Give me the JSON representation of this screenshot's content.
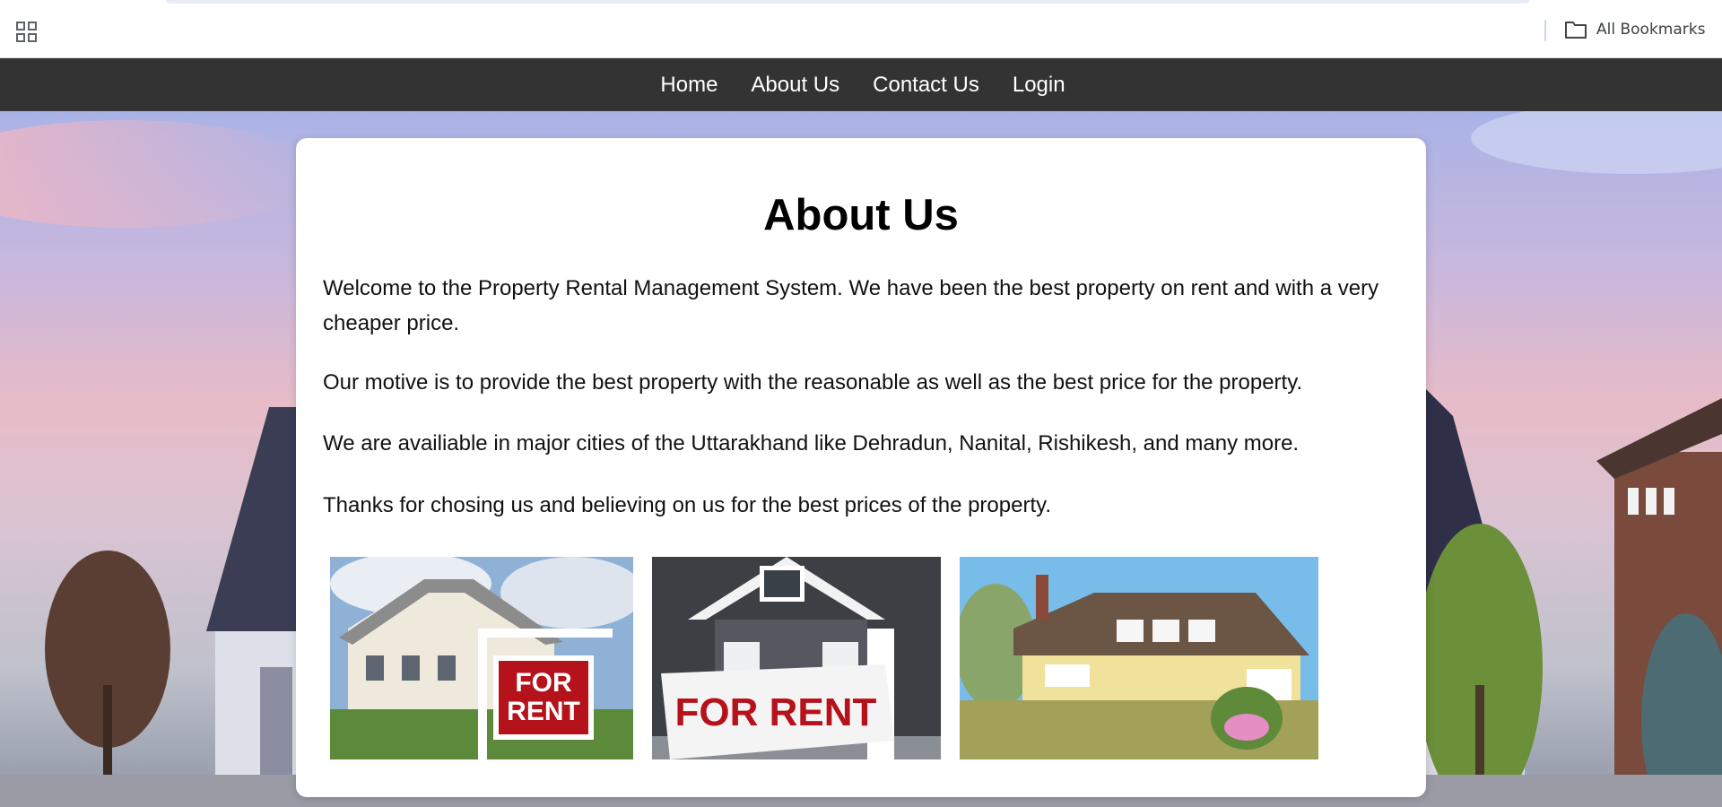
{
  "browser": {
    "apps_icon": "apps-grid-icon",
    "bookmarks_folder_icon": "folder-icon",
    "all_bookmarks_label": "All Bookmarks"
  },
  "nav": {
    "items": [
      {
        "label": "Home"
      },
      {
        "label": "About Us"
      },
      {
        "label": "Contact Us"
      },
      {
        "label": "Login"
      }
    ]
  },
  "about": {
    "heading": "About Us",
    "paragraphs": [
      "Welcome to the Property Rental Management System. We have been the best property on rent and with a very cheaper price.",
      "Our motive is to provide the best property with the reasonable as well as the best price for the property.",
      "We are availiable in major cities of the Uttarakhand like Dehradun, Nanital, Rishikesh, and many more.",
      "Thanks for chosing us and believing on us for the best prices of the property."
    ],
    "photos": [
      {
        "sign_line1": "FOR",
        "sign_line2": "RENT"
      },
      {
        "sign_text": "FOR RENT"
      },
      {}
    ]
  },
  "colors": {
    "nav_bg": "#333333",
    "nav_text": "#ffffff",
    "sign_red": "#b5121b"
  }
}
